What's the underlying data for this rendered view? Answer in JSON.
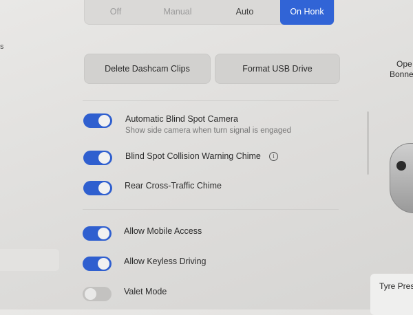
{
  "headlights_modes": {
    "options": [
      "Off",
      "Manual",
      "Auto",
      "On Honk"
    ],
    "selected": "On Honk"
  },
  "buttons": {
    "delete_clips": "Delete Dashcam Clips",
    "format_usb": "Format USB Drive"
  },
  "settings": [
    {
      "label": "Automatic Blind Spot Camera",
      "sub": "Show side camera when turn signal is engaged",
      "enabled": true
    },
    {
      "label": "Blind Spot Collision Warning Chime",
      "enabled": true
    },
    {
      "label": "Rear Cross-Traffic Chime",
      "enabled": true
    },
    {
      "label": "Allow Mobile Access",
      "enabled": true
    },
    {
      "label": "Allow Keyless Driving",
      "enabled": true
    },
    {
      "label": "Valet Mode",
      "enabled": false
    }
  ],
  "left_panel": {
    "fragment": "s"
  },
  "right_panel": {
    "line1": "Ope",
    "line2": "Bonne",
    "tyre": "Tyre Pres"
  },
  "icons": {
    "info": "info-icon"
  },
  "colors": {
    "accent": "#3164d6",
    "toggle_on": "#2f5fcf",
    "toggle_off": "#c3c2c0"
  }
}
